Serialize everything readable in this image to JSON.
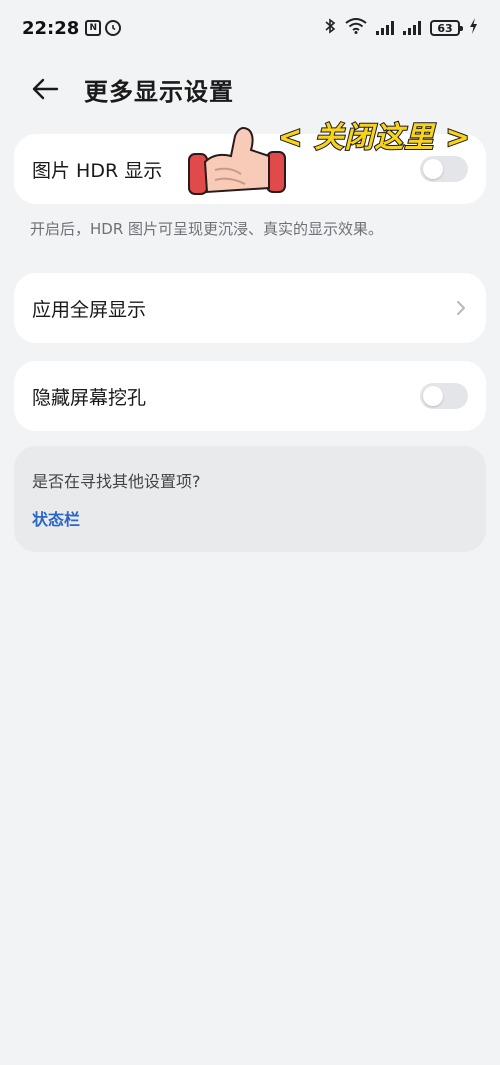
{
  "status_bar": {
    "time": "22:28",
    "nfc_icon_text": "N",
    "battery_level": "63"
  },
  "header": {
    "title": "更多显示设置"
  },
  "settings": {
    "hdr": {
      "label": "图片 HDR 显示",
      "enabled": false
    },
    "hdr_description": "开启后，HDR 图片可呈现更沉浸、真实的显示效果。",
    "fullscreen": {
      "label": "应用全屏显示"
    },
    "hide_notch": {
      "label": "隐藏屏幕挖孔",
      "enabled": false
    }
  },
  "annotation": {
    "text": "< 关闭这里 >",
    "color": "#f9d21b"
  },
  "suggestion": {
    "question": "是否在寻找其他设置项?",
    "link": "状态栏",
    "link_color": "#2a66c7"
  }
}
